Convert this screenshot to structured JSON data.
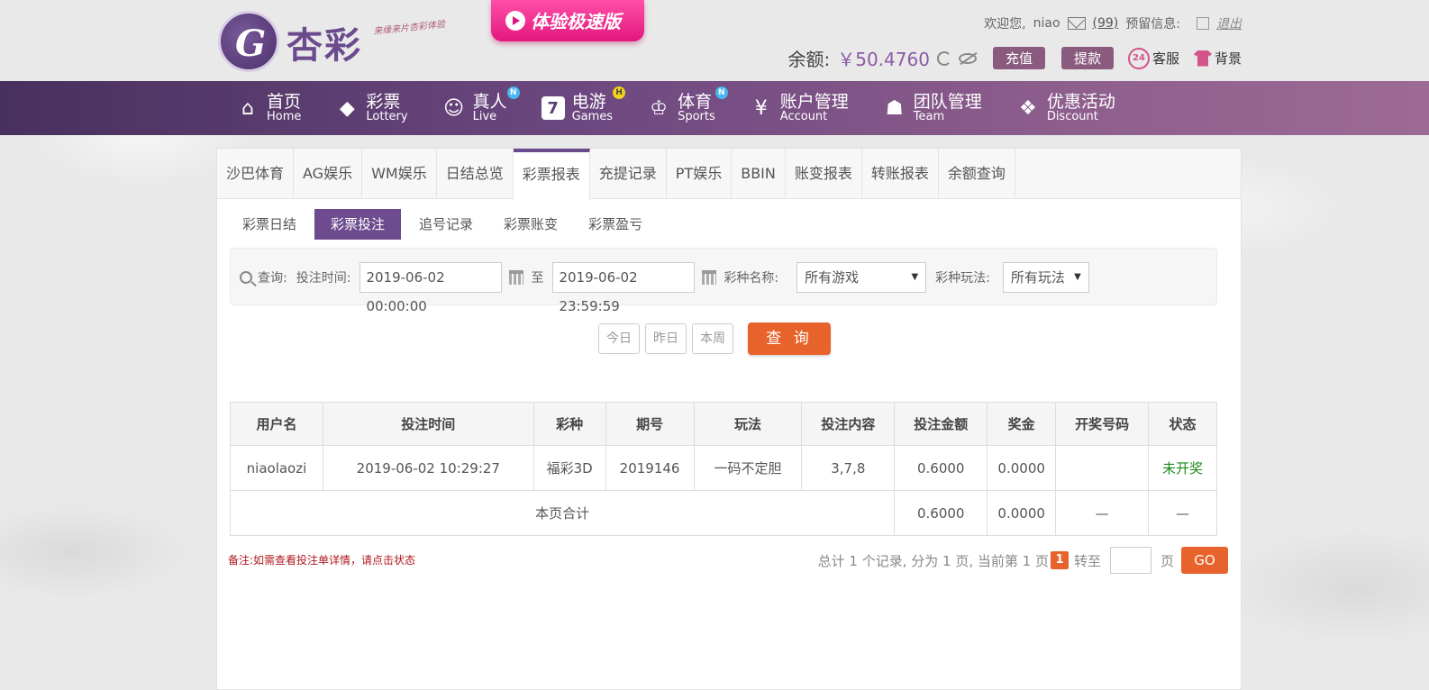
{
  "brand": {
    "logo_letter": "G",
    "name": "杏彩",
    "slogan": "来缘来片杏彩体验",
    "promo": "体验极速版"
  },
  "header": {
    "welcome": "欢迎您,",
    "username": "niao",
    "message_count": "(99)",
    "notice_label": "预留信息:",
    "logout": "退出",
    "balance_label": "余额:",
    "balance_value": "￥50.4760",
    "deposit": "充值",
    "withdraw": "提款",
    "service": "客服",
    "service_icon_text": "24",
    "background": "背景"
  },
  "nav": [
    {
      "zh": "首页",
      "en": "Home",
      "icon": "⌂"
    },
    {
      "zh": "彩票",
      "en": "Lottery",
      "icon": "◆"
    },
    {
      "zh": "真人",
      "en": "Live",
      "icon": "☺",
      "badge": "N"
    },
    {
      "zh": "电游",
      "en": "Games",
      "icon": "7",
      "badge": "H"
    },
    {
      "zh": "体育",
      "en": "Sports",
      "icon": "♔",
      "badge": "N"
    },
    {
      "zh": "账户管理",
      "en": "Account",
      "icon": "¥"
    },
    {
      "zh": "团队管理",
      "en": "Team",
      "icon": "☗"
    },
    {
      "zh": "优惠活动",
      "en": "Discount",
      "icon": "❖"
    }
  ],
  "tabs": [
    "沙巴体育",
    "AG娱乐",
    "WM娱乐",
    "日结总览",
    "彩票报表",
    "充提记录",
    "PT娱乐",
    "BBIN",
    "账变报表",
    "转账报表",
    "余额查询"
  ],
  "active_tab": 4,
  "subtabs": [
    "彩票日结",
    "彩票投注",
    "追号记录",
    "彩票账变",
    "彩票盈亏"
  ],
  "active_subtab": 1,
  "search": {
    "query_label": "查询:",
    "time_label": "投注时间:",
    "start_time": "2019-06-02 00:00:00",
    "to_label": "至",
    "end_time": "2019-06-02 23:59:59",
    "lottery_label": "彩种名称:",
    "lottery_value": "所有游戏",
    "play_label": "彩种玩法:",
    "play_value": "所有玩法",
    "today": "今日",
    "yesterday": "昨日",
    "this_week": "本周",
    "submit": "查 询"
  },
  "table": {
    "headers": [
      "用户名",
      "投注时间",
      "彩种",
      "期号",
      "玩法",
      "投注内容",
      "投注金额",
      "奖金",
      "开奖号码",
      "状态"
    ],
    "rows": [
      [
        "niaolaozi",
        "2019-06-02 10:29:27",
        "福彩3D",
        "2019146",
        "一码不定胆",
        "3,7,8",
        "0.6000",
        "0.0000",
        "",
        "未开奖"
      ]
    ],
    "summary": {
      "label": "本页合计",
      "amount": "0.6000",
      "bonus": "0.0000",
      "draw": "—",
      "status": "—"
    }
  },
  "note": "备注:如需查看投注单详情，请点击状态",
  "pager": {
    "summary": "总计 1 个记录, 分为 1 页, 当前第 1 页",
    "current": "1",
    "goto_label": "转至",
    "page_unit": "页",
    "go": "GO"
  },
  "colors": {
    "accent": "#6d4b8e",
    "orange": "#e8632c",
    "status_green": "#1a8a1a"
  }
}
